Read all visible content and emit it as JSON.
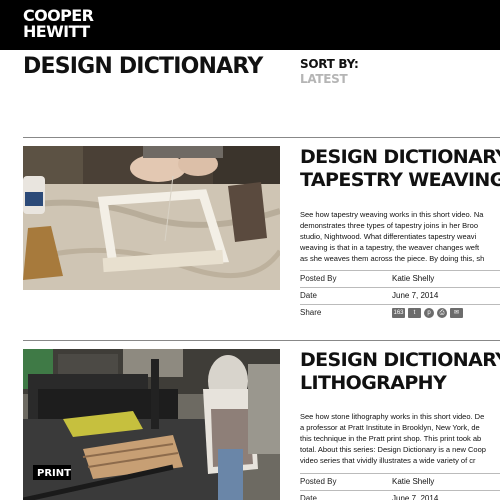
{
  "brand": {
    "logo_line1": "COOPER",
    "logo_line2": "HEWITT"
  },
  "header": {
    "title": "DESIGN DICTIONARY",
    "sort_label": "SORT BY:",
    "sort_value": "LATEST"
  },
  "articles": [
    {
      "title_line1": "DESIGN DICTIONARY:",
      "title_line2": "TAPESTRY WEAVING",
      "desc_lines": [
        "See how tapestry weaving works in this short video. Na",
        "demonstrates three types of tapestry joins in her Broo",
        "studio, Nightwood. What differentiates tapestry weavi",
        "weaving is that in a tapestry, the weaver changes weft",
        "as she weaves them across the piece. By doing this, sh"
      ],
      "posted_by_label": "Posted By",
      "posted_by": "Katie Shelly",
      "date_label": "Date",
      "date": "June 7, 2014",
      "share_label": "Share",
      "share_count": "163"
    },
    {
      "title_line1": "DESIGN DICTIONARY: ST",
      "title_line2": "LITHOGRAPHY",
      "thumb_caption": "PRINT",
      "desc_lines": [
        "See how stone lithography works in this short video. De",
        "a professor at Pratt Institute in Brooklyn, New York, de",
        "this technique in the Pratt print shop. This print took ab",
        "total. About this series: Design Dictionary is a new Coop",
        "video series that vividly illustrates a wide variety of cr"
      ],
      "posted_by_label": "Posted By",
      "posted_by": "Katie Shelly",
      "date_label": "Date",
      "date": "June 7, 2014"
    }
  ]
}
